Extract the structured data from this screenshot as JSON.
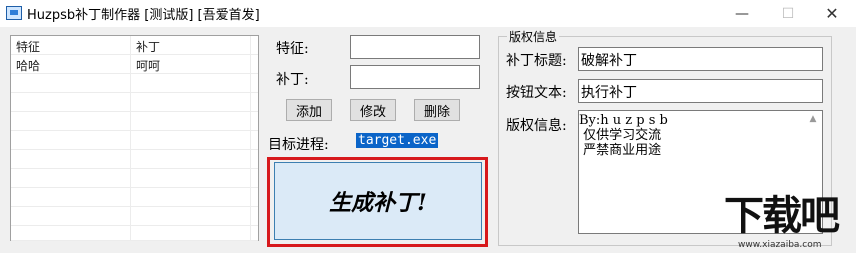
{
  "window": {
    "title": "Huzpsb补丁制作器 [测试版] [吾爱首发]",
    "minimize_icon": "minimize-icon",
    "maximize_icon": "maximize-icon",
    "close_icon": "close-icon"
  },
  "list": {
    "columns": [
      "特征",
      "补丁"
    ],
    "rows": [
      [
        "哈哈",
        "呵呵"
      ]
    ]
  },
  "form": {
    "feature_label": "特征:",
    "feature_value": "",
    "patch_label": "补丁:",
    "patch_value": "",
    "add_label": "添加",
    "modify_label": "修改",
    "delete_label": "删除",
    "target_label": "目标进程:",
    "target_value": "target.exe",
    "generate_label": "生成补丁!"
  },
  "copyright": {
    "group_title": "版权信息",
    "patch_title_label": "补丁标题:",
    "patch_title_value": "破解补丁",
    "button_text_label": "按钮文本:",
    "button_text_value": "执行补丁",
    "info_label": "版权信息:",
    "info_lines": [
      "By:h u z p s b",
      " 仅供学习交流",
      " 严禁商业用途"
    ]
  },
  "watermark": {
    "text": "下载吧",
    "url": "www.xiazaiba.com"
  },
  "colors": {
    "selection": "#0a64c8",
    "highlight_border": "#d7191c",
    "generate_button_bg": "#dbeaf7"
  }
}
